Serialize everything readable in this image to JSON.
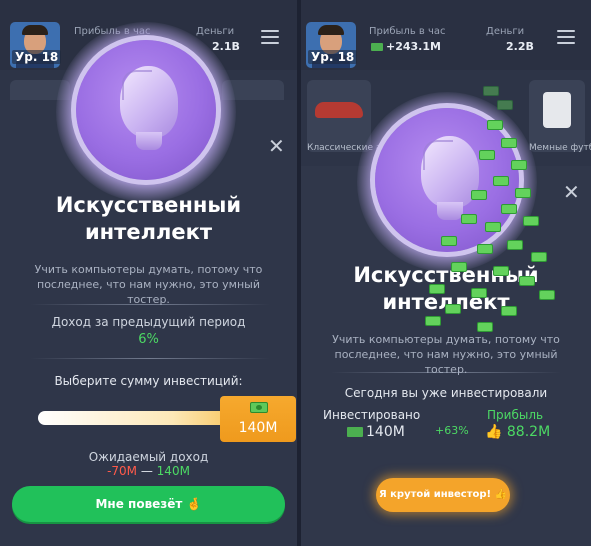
{
  "left": {
    "topbar": {
      "level": "Ур. 18",
      "profit_label": "Прибыль в час",
      "money_label": "Деньги",
      "money_value": "2.1B"
    },
    "modal": {
      "title": "Искусственный интеллект",
      "description": "Учить компьютеры думать, потому что последнее, что нам нужно, это умный тостер.",
      "income_label": "Доход за предыдущий период",
      "income_value": "6%",
      "choose_label": "Выберите сумму инвестиций:",
      "slider_value": "140M",
      "slider_fraction": 1.0,
      "expected_label": "Ожидаемый доход",
      "expected_low": "-70M",
      "expected_dash": "—",
      "expected_high": "140M",
      "cta_label": "Мне повезёт 🤞"
    }
  },
  "right": {
    "topbar": {
      "level": "Ур. 18",
      "profit_label": "Прибыль в час",
      "profit_value": "+243.1M",
      "money_label": "Деньги",
      "money_value": "2.2B"
    },
    "cards": [
      {
        "label": "Классические автомобили"
      },
      {
        "label": "Мемные футболки"
      }
    ],
    "modal": {
      "title": "Искусственный интеллект",
      "description": "Учить компьютеры думать, потому что последнее, что нам нужно, это умный тостер.",
      "invested_today_label": "Сегодня вы уже инвестировали",
      "invested_label": "Инвестировано",
      "invested_value": "140M",
      "percent": "+63%",
      "profit_label": "Прибыль",
      "profit_value": "88.2M",
      "cta_label": "Я крутой инвестор! 👍"
    }
  },
  "icons": [
    "close-icon",
    "menu-icon",
    "cash-icon",
    "thumbs-up-icon",
    "ai-head-icon",
    "info-icon"
  ],
  "colors": {
    "accent_green": "#21c15a",
    "accent_orange": "#f4a42a",
    "profit_green": "#4cd964",
    "loss_red": "#ff5a4a",
    "modal_bg": "#2f3649"
  }
}
